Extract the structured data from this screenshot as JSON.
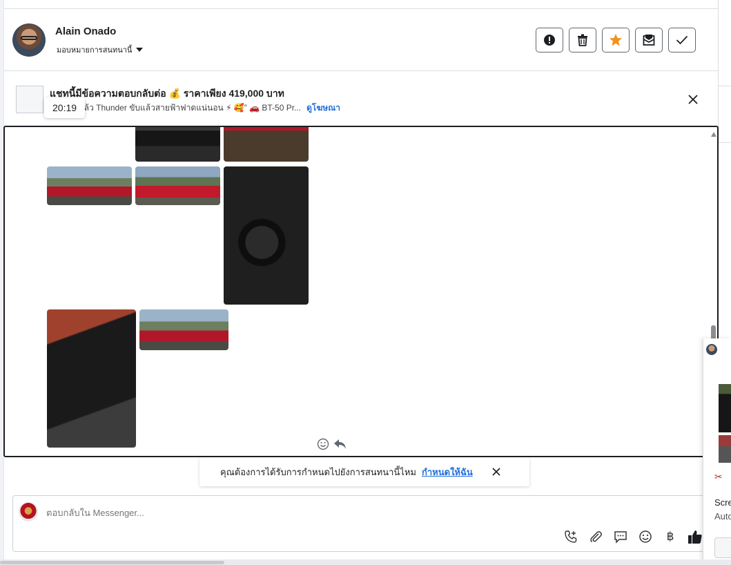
{
  "header": {
    "name": "Alain Onado",
    "assign_label": "มอบหมายการสนทนานี้",
    "actions": [
      "spam-icon",
      "trash-icon",
      "star-icon",
      "mark-unread-icon",
      "done-icon"
    ]
  },
  "ad": {
    "title": "แชทนี้มีข้อความตอบกลับต่อ 💰 ราคาเพียง 419,000 บาท",
    "subtitle": "แล้ว Thunder ขับแล้วสายฟ้าฟาดแน่นอน ⚡ 🥰” 🚗 BT-50 Pr...",
    "link": "ดูโฆษณา",
    "tooltip_time": "20:19"
  },
  "notice": {
    "text": "คุณต้องการได้รับการกำหนดไปยังการสนทนานี้ไหม",
    "link": "กำหนดให้ฉัน"
  },
  "composer": {
    "placeholder": "ตอบกลับใน Messenger...",
    "currency_symbol": "฿",
    "tools": [
      "phone-icon",
      "attach-icon",
      "comment-icon",
      "emoji-icon",
      "baht-icon",
      "like-icon"
    ]
  },
  "side_panel": {
    "text1": "Scre",
    "text2": "Auto"
  },
  "colors": {
    "accent": "#216fdb",
    "star": "#f0921f",
    "border_dark": "#1c1e21"
  }
}
